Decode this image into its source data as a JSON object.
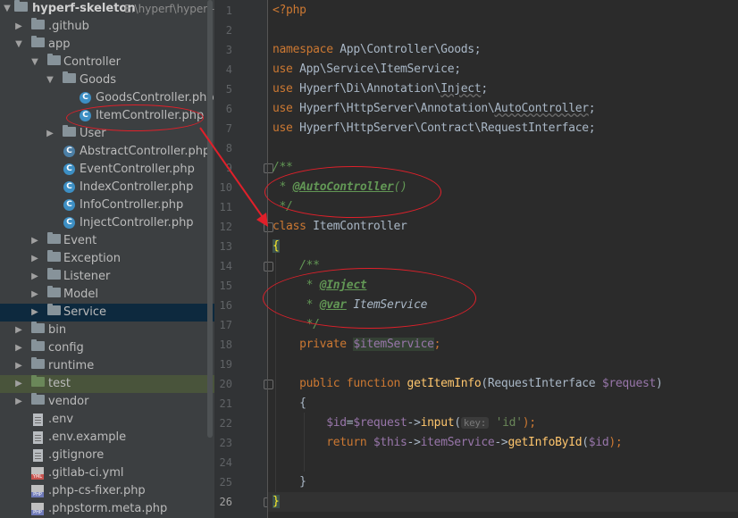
{
  "project": {
    "name": "hyperf-skeleton",
    "path": "E:\\hyperf\\hyperf-s"
  },
  "tree": [
    {
      "label": ".github",
      "kind": "folder",
      "expanded": false
    },
    {
      "label": "app",
      "kind": "folder",
      "expanded": true
    },
    {
      "label": "Controller",
      "kind": "folder",
      "expanded": true
    },
    {
      "label": "Goods",
      "kind": "folder",
      "expanded": true
    },
    {
      "label": "GoodsController.php",
      "kind": "class"
    },
    {
      "label": "ItemController.php",
      "kind": "class"
    },
    {
      "label": "User",
      "kind": "folder",
      "expanded": false
    },
    {
      "label": "AbstractController.php",
      "kind": "class"
    },
    {
      "label": "EventController.php",
      "kind": "class"
    },
    {
      "label": "IndexController.php",
      "kind": "class"
    },
    {
      "label": "InfoController.php",
      "kind": "class"
    },
    {
      "label": "InjectController.php",
      "kind": "class"
    },
    {
      "label": "Event",
      "kind": "folder",
      "expanded": false
    },
    {
      "label": "Exception",
      "kind": "folder",
      "expanded": false
    },
    {
      "label": "Listener",
      "kind": "folder",
      "expanded": false
    },
    {
      "label": "Model",
      "kind": "folder",
      "expanded": false
    },
    {
      "label": "Service",
      "kind": "folder",
      "expanded": false,
      "state": "selected"
    },
    {
      "label": "bin",
      "kind": "folder",
      "expanded": false
    },
    {
      "label": "config",
      "kind": "folder",
      "expanded": false
    },
    {
      "label": "runtime",
      "kind": "folder",
      "expanded": false
    },
    {
      "label": "test",
      "kind": "folder-green",
      "expanded": false,
      "state": "highlighted"
    },
    {
      "label": "vendor",
      "kind": "folder",
      "expanded": false
    },
    {
      "label": ".env",
      "kind": "file"
    },
    {
      "label": ".env.example",
      "kind": "file"
    },
    {
      "label": ".gitignore",
      "kind": "file"
    },
    {
      "label": ".gitlab-ci.yml",
      "kind": "yml"
    },
    {
      "label": ".php-cs-fixer.php",
      "kind": "php"
    },
    {
      "label": ".phpstorm.meta.php",
      "kind": "php"
    }
  ],
  "line_numbers": [
    "1",
    "2",
    "3",
    "4",
    "5",
    "6",
    "7",
    "8",
    "9",
    "10",
    "11",
    "12",
    "13",
    "14",
    "15",
    "16",
    "17",
    "18",
    "19",
    "20",
    "21",
    "22",
    "23",
    "24",
    "25",
    "26"
  ],
  "code": {
    "php_open": "<?php",
    "namespace_kw": "namespace",
    "namespace_path": " App\\Controller\\Goods;",
    "use_kw": "use",
    "use1": " App\\Service\\ItemService;",
    "use2a": " Hyperf\\Di\\Annotation\\",
    "use2b": "Inject",
    "use2c": ";",
    "use3a": " Hyperf\\HttpServer\\Annotation\\",
    "use3b": "AutoController",
    "use3c": ";",
    "use4": " Hyperf\\HttpServer\\Contract\\RequestInterface;",
    "doc_open": "/**",
    "doc_star": " * ",
    "auto_tag": "@AutoController",
    "auto_paren": "()",
    "doc_close": " */",
    "class_kw": "class",
    "class_name": " ItemController",
    "brace_open": "{",
    "doc2_open": "    /**",
    "doc2_star": "     * ",
    "inject_tag": "@Inject",
    "var_tag": "@var",
    "var_type": " ItemService",
    "doc2_close": "     */",
    "private_kw": "    private ",
    "prop": "$itemService",
    "semi": ";",
    "public_kw": "    public function ",
    "method": "getItemInfo",
    "param_type": "(RequestInterface ",
    "param": "$request",
    "param_close": ")",
    "m_brace_open": "    {",
    "id_var": "        $id",
    "eq": "=",
    "req_var": "$request",
    "arrow1": "->",
    "input_fn": "input",
    "paren_open": "(",
    "hint_key": "key:",
    "id_str": "'id'",
    "close_semi": ");",
    "return_kw": "        return ",
    "this_var": "$this",
    "arrow2": "->",
    "item_prop": "itemService",
    "arrow3": "->",
    "get_fn": "getInfoById",
    "paren2": "(",
    "id_var2": "$id",
    "close2": ");",
    "m_brace_close": "    }",
    "brace_close": "}"
  },
  "colors": {
    "keyword": "#cc7832",
    "doc_comment": "#629755",
    "variable": "#9876aa",
    "function": "#ffc66d",
    "string": "#6a8759",
    "annotation_ring": "#e0202a"
  }
}
